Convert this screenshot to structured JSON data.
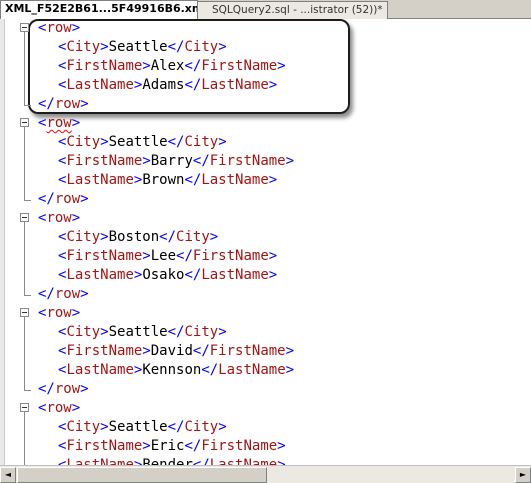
{
  "tabs": [
    {
      "label": "XML_F52E2B61...5F49916B6.xml",
      "active": true
    },
    {
      "label": "SQLQuery2.sql - ...istrator (52))*",
      "active": false
    }
  ],
  "xml": {
    "row_tag": "row",
    "city_tag": "City",
    "first_tag": "FirstName",
    "last_tag": "LastName",
    "rows": [
      {
        "city": "Seattle",
        "first": "Alex",
        "last": "Adams"
      },
      {
        "city": "Seattle",
        "first": "Barry",
        "last": "Brown"
      },
      {
        "city": "Boston",
        "first": "Lee",
        "last": "Osako"
      },
      {
        "city": "Seattle",
        "first": "David",
        "last": "Kennson"
      },
      {
        "city": "Seattle",
        "first": "Eric",
        "last": "Bender"
      }
    ]
  },
  "scrollbar": {
    "left_arrow": "◄",
    "right_arrow": "►"
  },
  "colors": {
    "bracket": "#0000ff",
    "element_name": "#a31515",
    "text": "#000000",
    "tab_strip": "#d4d0c8"
  }
}
